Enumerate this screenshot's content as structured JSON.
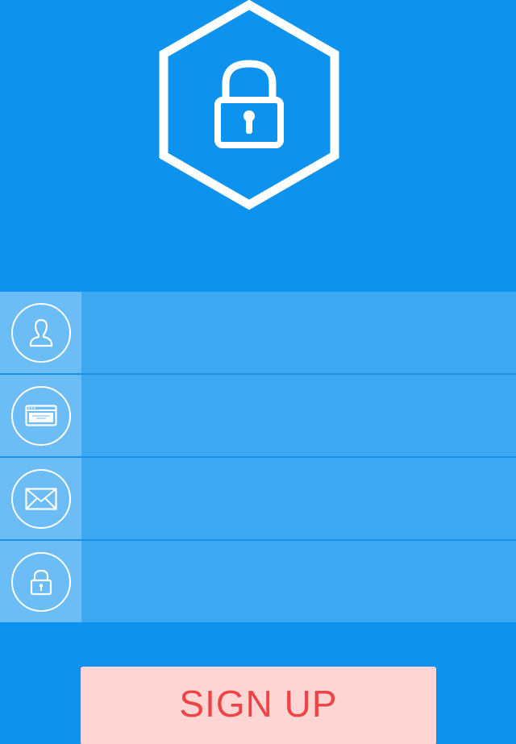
{
  "colors": {
    "background": "#0d93ee",
    "icon_cell": "#6cbcf5",
    "input_bg": "#3ea7f1",
    "button_bg": "#ffd6d4",
    "button_text": "#ee4448"
  },
  "logo": {
    "icon": "hexagon-padlock-icon"
  },
  "fields": [
    {
      "icon": "user-icon",
      "value": "",
      "placeholder": ""
    },
    {
      "icon": "browser-window-icon",
      "value": "",
      "placeholder": ""
    },
    {
      "icon": "envelope-icon",
      "value": "",
      "placeholder": ""
    },
    {
      "icon": "padlock-icon",
      "value": "",
      "placeholder": ""
    }
  ],
  "signup": {
    "label": "SIGN UP"
  }
}
